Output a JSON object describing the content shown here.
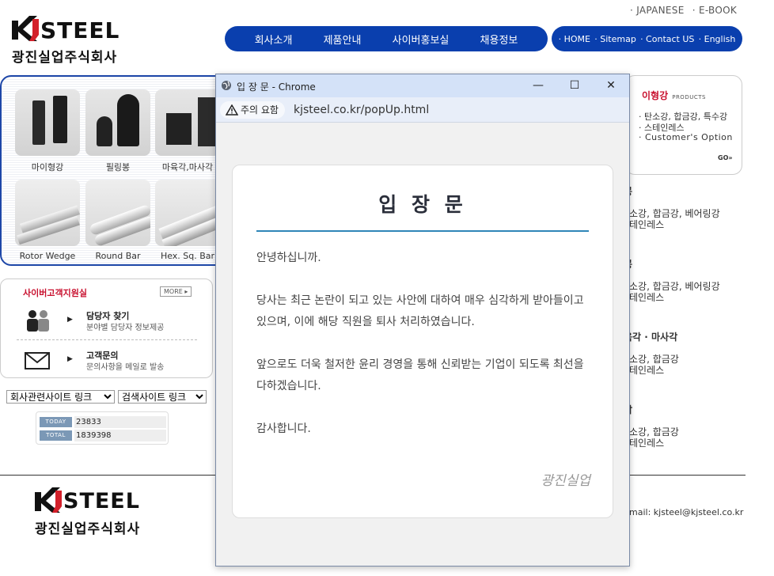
{
  "header": {
    "top_links": [
      "· JAPANESE",
      "· E-BOOK"
    ],
    "logo_text": "KJSTEEL",
    "logo_korean": "광진실업주식회사"
  },
  "main_nav": [
    "회사소개",
    "제품안내",
    "사이버홍보실",
    "채용정보"
  ],
  "sub_nav": [
    "· HOME",
    "· Sitemap",
    "· Contact US",
    "· English"
  ],
  "products": [
    {
      "label": "마이형강",
      "icon": "profile-steel-icon"
    },
    {
      "label": "필링봉",
      "icon": "peeled-bar-icon"
    },
    {
      "label": "마육각,마사각",
      "icon": "hex-square-bar-icon"
    },
    {
      "label": "Rotor Wedge",
      "icon": "rotor-wedge-icon"
    },
    {
      "label": "Round Bar",
      "icon": "round-bar-icon"
    },
    {
      "label": "Hex. Sq. Bar",
      "icon": "hex-sq-bar-icon"
    }
  ],
  "cyber_support": {
    "title": "사이버고객지원실",
    "more": "MORE",
    "items": [
      {
        "title": "담당자 찾기",
        "desc": "분야별 담당자 정보제공",
        "icon": "people-icon"
      },
      {
        "title": "고객문의",
        "desc": "문의사항을 메일로 발송",
        "icon": "mail-icon"
      }
    ]
  },
  "site_links": {
    "company_select": "회사관련사이트 링크",
    "search_select": "검색사이트 링크"
  },
  "counter": {
    "today_label": "TODAY",
    "today_value": "23833",
    "total_label": "TOTAL",
    "total_value": "1839398"
  },
  "right_panel": {
    "box_title": "이형강",
    "box_subtitle": "PRODUCTS",
    "box_lines": [
      "· 탄소강, 합금강, 특수강",
      "· 스테인레스",
      "· Customer's Option"
    ],
    "box_go": "GO",
    "sections": [
      {
        "title": "봉",
        "lines": [
          "소강, 합금강, 베어링강",
          "테인레스"
        ]
      },
      {
        "title": "봉",
        "lines": [
          "소강, 합금강, 베어링강",
          "테인레스"
        ]
      },
      {
        "title": "육각 · 마사각",
        "lines": [
          "소강, 합금강",
          "테인레스"
        ]
      },
      {
        "title": "각",
        "lines": [
          "소강, 합금강",
          "테인레스"
        ]
      }
    ],
    "email": "mail: kjsteel@kjsteel.co.kr"
  },
  "popup": {
    "window_title": "입 장 문 - Chrome",
    "security_label": "주의 요함",
    "url": "kjsteel.co.kr/popUp.html",
    "heading": "입 장 문",
    "greeting": "안녕하십니까.",
    "para1": "당사는 최근 논란이 되고 있는 사안에 대하여 매우 심각하게 받아들이고 있으며, 이에 해당 직원을 퇴사 처리하였습니다.",
    "para2": "앞으로도 더욱 철저한 윤리 경영을 통해 신뢰받는 기업이 되도록 최선을 다하겠습니다.",
    "closing": "감사합니다.",
    "signature": "광진실업"
  }
}
